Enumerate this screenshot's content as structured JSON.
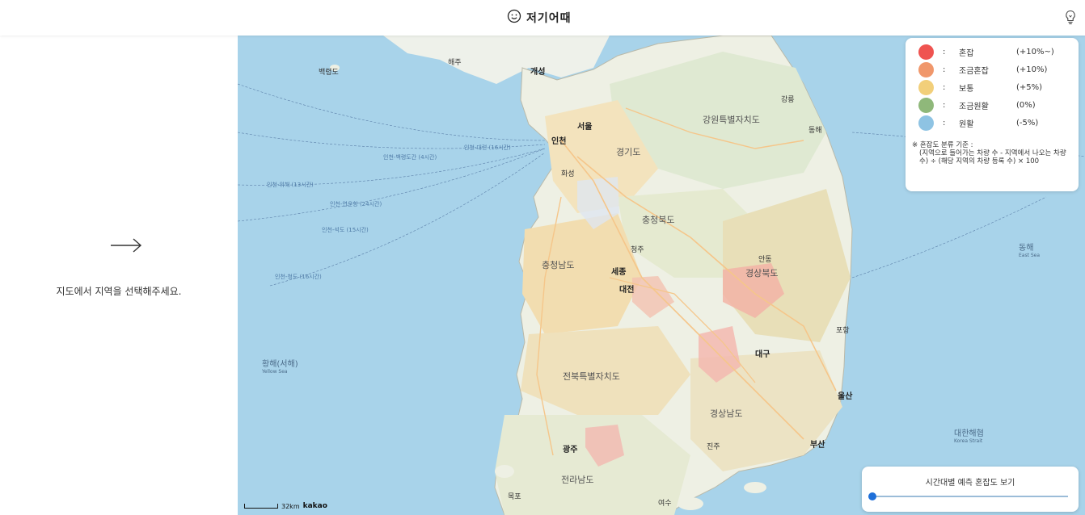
{
  "header": {
    "title": "저기어때",
    "logo_icon": "smile-icon",
    "tip_icon": "lightbulb-icon"
  },
  "left_panel": {
    "arrow_icon": "arrow-right-icon",
    "prompt": "지도에서 지역을 선택해주세요."
  },
  "map": {
    "provider": "kakao",
    "scale_label": "32km",
    "labels": {
      "gangwon": "강원특별자치도",
      "gyeonggi": "경기도",
      "chungbuk": "충청북도",
      "chungnam": "충청남도",
      "gyeongbuk": "경상북도",
      "jeonbuk": "전북특별자치도",
      "gyeongnam": "경상남도",
      "jeonnam": "전라남도",
      "seoul": "서울",
      "incheon": "인천",
      "daejeon": "대전",
      "sejong": "세종",
      "daegu": "대구",
      "ulsan": "울산",
      "busan": "부산",
      "gwangju": "광주",
      "gaeseong": "개성",
      "haeju": "해주",
      "baengnyeongdo": "백령도",
      "gangneung": "강릉",
      "donghae_city": "동해",
      "pohang": "포항",
      "cheongju": "청주",
      "suwon": "화성",
      "mokpo": "목포",
      "yeosu": "여수",
      "jinju": "진주",
      "andong": "안동",
      "yellow_sea": "황해(서해)",
      "yellow_sea_en": "Yellow Sea",
      "east_sea": "동해",
      "east_sea_en": "East Sea",
      "korea_strait": "대한해협",
      "korea_strait_en": "Korea Strait",
      "route_1": "인천-위해 (13시간)",
      "route_2": "인천-연운항 (24시간)",
      "route_3": "인천-석도 (15시간)",
      "route_4": "인천-청도 (16시간)",
      "route_5": "인천-대련 (16시간)",
      "route_6": "인천-백령도간 (4시간)"
    }
  },
  "legend": {
    "items": [
      {
        "color": "#ef5350",
        "label": "혼잡",
        "range": "(+10%~)"
      },
      {
        "color": "#f0976b",
        "label": "조금혼잡",
        "range": "(+10%)"
      },
      {
        "color": "#f2cf7a",
        "label": "보통",
        "range": "(+5%)"
      },
      {
        "color": "#8fb87a",
        "label": "조금원활",
        "range": "(0%)"
      },
      {
        "color": "#8ec3e3",
        "label": "원활",
        "range": "(-5%)"
      }
    ],
    "colon": ":",
    "note_title": "※ 혼잡도 분류 기준 :",
    "note_body": "(지역으로 들어가는 차량 수 - 지역에서 나오는 차량 수) ÷ (해당 지역의 차량 등록 수) × 100"
  },
  "time_panel": {
    "title": "시간대별 예측 혼잡도 보기",
    "slider_value": 0
  }
}
